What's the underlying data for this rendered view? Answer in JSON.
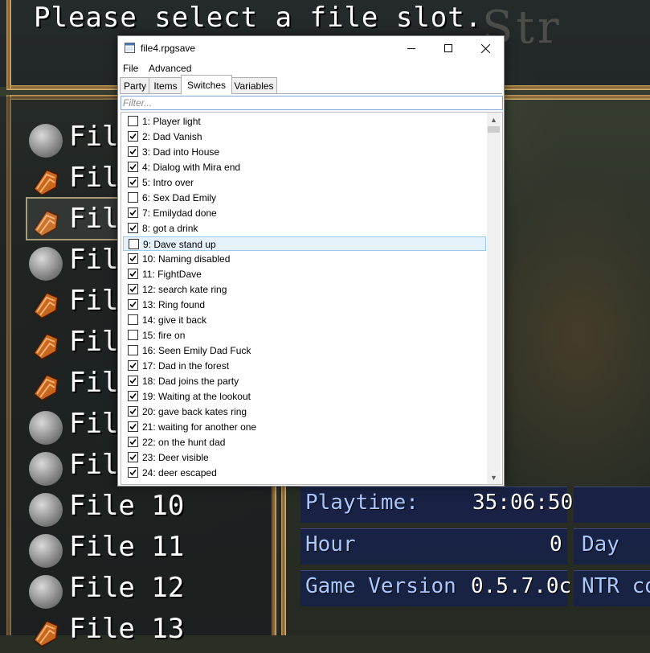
{
  "game": {
    "help_text": "Please select a file slot.",
    "logo_fragment": "Str",
    "slots": [
      {
        "label": "File 1",
        "icon": "grey-circle"
      },
      {
        "label": "File 2",
        "icon": "crest"
      },
      {
        "label": "File 3",
        "icon": "crest"
      },
      {
        "label": "File 4",
        "icon": "grey-circle"
      },
      {
        "label": "File 5",
        "icon": "crest"
      },
      {
        "label": "File 6",
        "icon": "crest"
      },
      {
        "label": "File 7",
        "icon": "crest"
      },
      {
        "label": "File 8",
        "icon": "grey-circle"
      },
      {
        "label": "File 9",
        "icon": "grey-circle"
      },
      {
        "label": "File 10",
        "icon": "grey-circle"
      },
      {
        "label": "File 11",
        "icon": "grey-circle"
      },
      {
        "label": "File 12",
        "icon": "grey-circle"
      },
      {
        "label": "File 13",
        "icon": "crest"
      }
    ],
    "info": {
      "playtime_label": "Playtime:",
      "playtime_value": "35:06:50",
      "hour_label": "Hour",
      "hour_value": "0",
      "day_label": "Day",
      "version_label": "Game Version",
      "version_value": "0.5.7.0c",
      "ntr_label": "NTR co"
    }
  },
  "editor": {
    "title": "file4.rpgsave",
    "menu": [
      "File",
      "Advanced"
    ],
    "tabs": [
      "Party",
      "Items",
      "Switches",
      "Variables"
    ],
    "active_tab": "Switches",
    "filter_placeholder": "Filter...",
    "selected_index": 8,
    "switches": [
      {
        "label": "1: Player light",
        "checked": false
      },
      {
        "label": "2: Dad Vanish",
        "checked": true
      },
      {
        "label": "3: Dad into House",
        "checked": true
      },
      {
        "label": "4: Dialog with Mira end",
        "checked": true
      },
      {
        "label": "5: Intro over",
        "checked": true
      },
      {
        "label": "6: Sex Dad Emily",
        "checked": false
      },
      {
        "label": "7: Emilydad done",
        "checked": true
      },
      {
        "label": "8: got a drink",
        "checked": true
      },
      {
        "label": "9: Dave stand up",
        "checked": false
      },
      {
        "label": "10: Naming disabled",
        "checked": true
      },
      {
        "label": "11: FightDave",
        "checked": true
      },
      {
        "label": "12: search kate ring",
        "checked": true
      },
      {
        "label": "13: Ring found",
        "checked": true
      },
      {
        "label": "14: give it back",
        "checked": false
      },
      {
        "label": "15: fire on",
        "checked": false
      },
      {
        "label": "16: Seen Emily Dad Fuck",
        "checked": false
      },
      {
        "label": "17: Dad in the forest",
        "checked": true
      },
      {
        "label": "18: Dad joins the party",
        "checked": true
      },
      {
        "label": "19: Waiting at the lookout",
        "checked": true
      },
      {
        "label": "20: gave back kates ring",
        "checked": true
      },
      {
        "label": "21: waiting for another one",
        "checked": true
      },
      {
        "label": "22: on the hunt dad",
        "checked": true
      },
      {
        "label": "23: Deer visible",
        "checked": true
      },
      {
        "label": "24: deer escaped",
        "checked": true
      }
    ]
  }
}
